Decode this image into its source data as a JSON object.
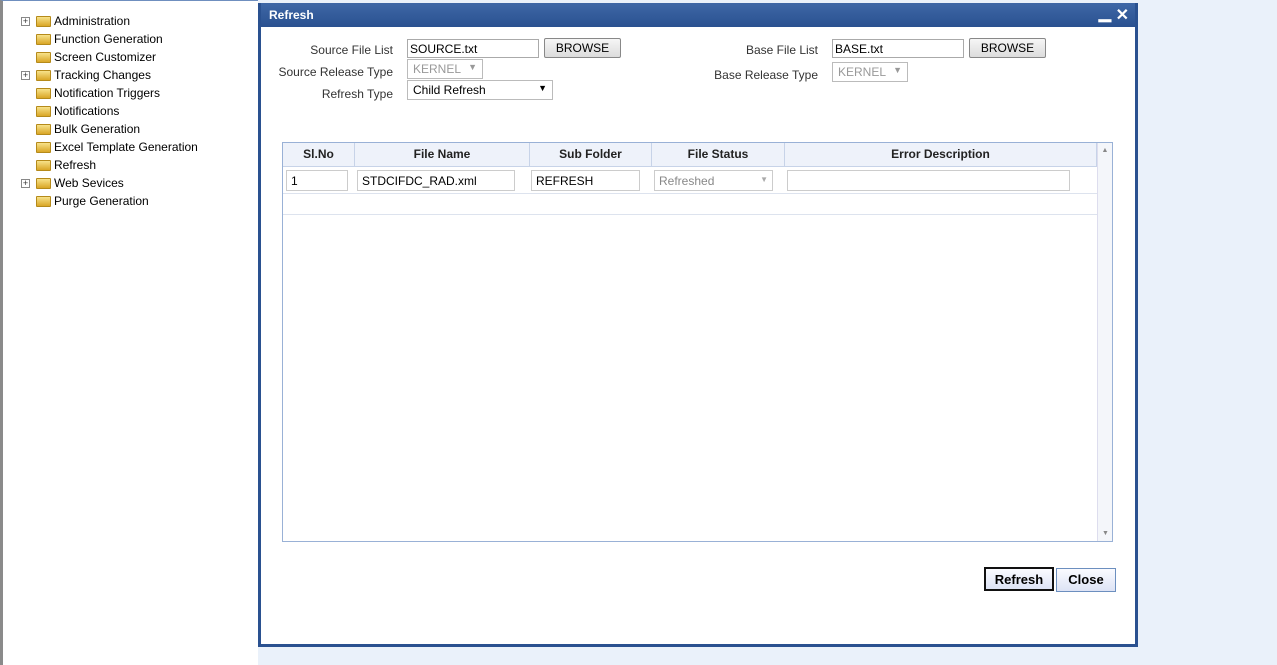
{
  "tree": [
    {
      "label": "Administration",
      "expandable": true
    },
    {
      "label": "Function Generation",
      "expandable": false
    },
    {
      "label": "Screen Customizer",
      "expandable": false
    },
    {
      "label": "Tracking Changes",
      "expandable": true
    },
    {
      "label": "Notification Triggers",
      "expandable": false
    },
    {
      "label": "Notifications",
      "expandable": false
    },
    {
      "label": "Bulk Generation",
      "expandable": false
    },
    {
      "label": "Excel Template Generation",
      "expandable": false
    },
    {
      "label": "Refresh",
      "expandable": false
    },
    {
      "label": "Web Sevices",
      "expandable": true
    },
    {
      "label": "Purge Generation",
      "expandable": false
    }
  ],
  "dialog": {
    "title": "Refresh",
    "minimize": "▁",
    "close": "✕",
    "source_file_label": "Source File List",
    "source_file_value": "SOURCE.txt",
    "browse": "BROWSE",
    "source_release_label": "Source Release Type",
    "source_release_value": "KERNEL",
    "refresh_type_label": "Refresh Type",
    "refresh_type_value": "Child Refresh",
    "base_file_label": "Base File List",
    "base_file_value": "BASE.txt",
    "base_release_label": "Base Release Type",
    "base_release_value": "KERNEL",
    "refresh_button": "Refresh",
    "close_button": "Close"
  },
  "grid": {
    "headers": [
      "Sl.No",
      "File Name",
      "Sub Folder",
      "File Status",
      "Error Description"
    ],
    "rows": [
      {
        "slno": "1",
        "file_name": "STDCIFDC_RAD.xml",
        "sub_folder": "REFRESH",
        "file_status": "Refreshed",
        "error": ""
      }
    ]
  }
}
